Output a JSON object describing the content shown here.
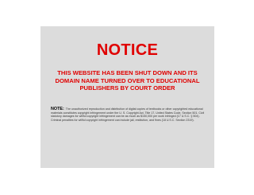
{
  "notice": {
    "heading": "NOTICE",
    "message": "THIS WEBSITE HAS BEEN SHUT DOWN AND ITS DOMAIN NAME TURNED OVER TO EDUCATIONAL PUBLISHERS BY COURT ORDER",
    "note_label": "NOTE:",
    "note_text": "The unauthorized reproduction and distribution of digital copies of textbooks or other copyrighted educational materials constitutes copyright infringement under the U. S. Copyright Act, Title 17, United States Code, Section 501. Civil statutory damages for willful copyright infringement can be as much as $150,000 per work infringed (17 U.S.C. § 504). Criminal penalties for willful copyright infringement can include jail, restitution, and fines (18 U.S.C. Section 2319)."
  },
  "colors": {
    "panel_background": "#dcdcdc",
    "alert_red": "#e00000",
    "page_background": "#ffffff"
  }
}
